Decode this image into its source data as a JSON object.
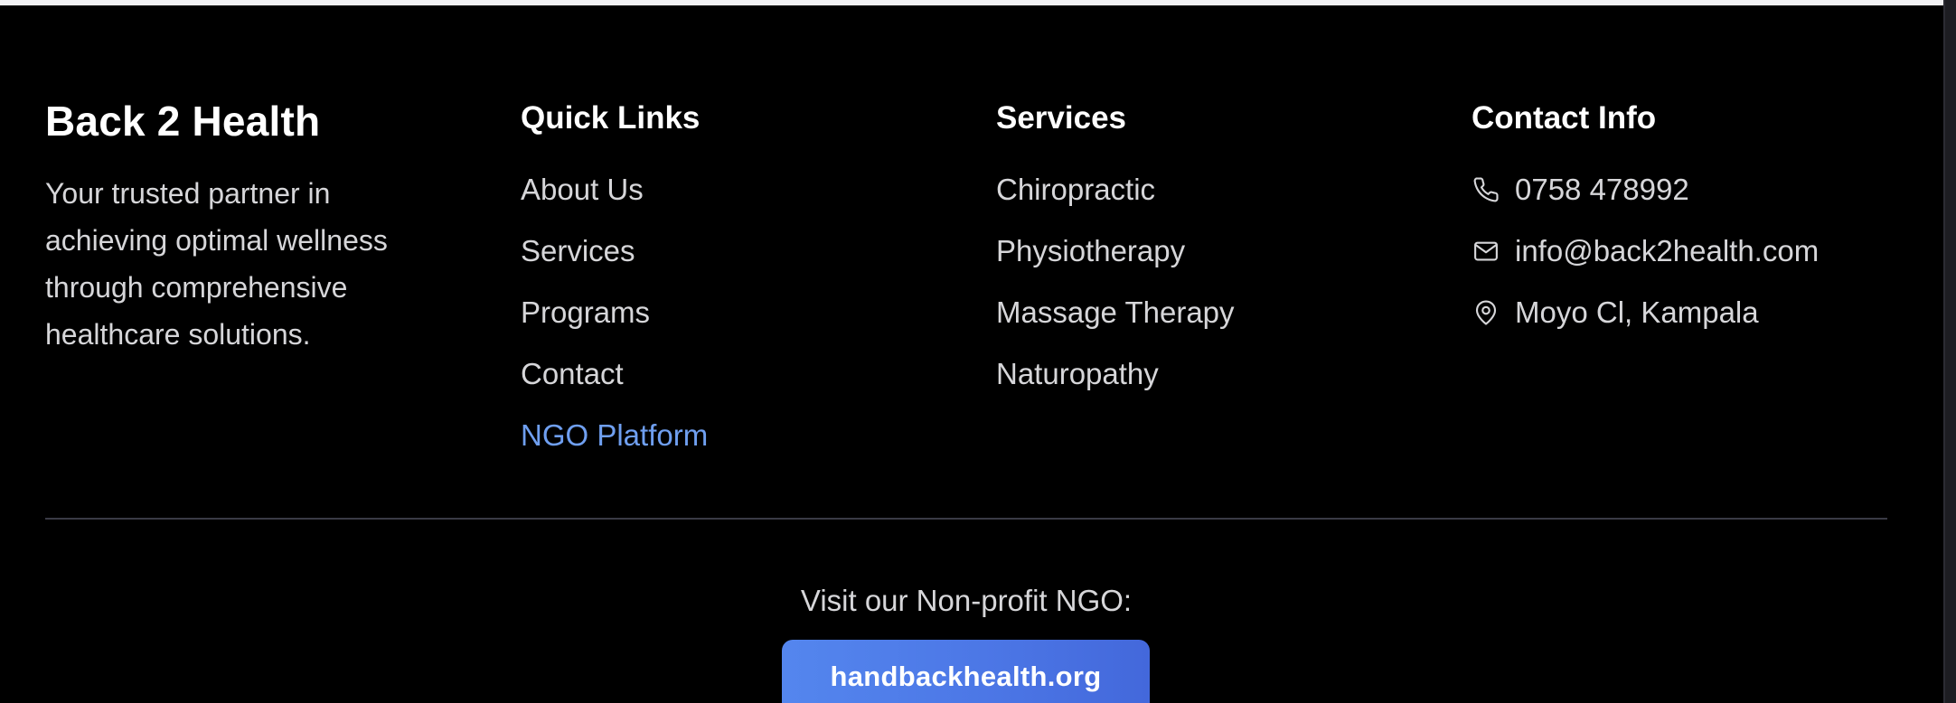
{
  "brand": {
    "title": "Back 2 Health",
    "tagline": "Your trusted partner in achieving optimal wellness through comprehensive healthcare solutions."
  },
  "quick_links": {
    "heading": "Quick Links",
    "items": [
      {
        "label": "About Us"
      },
      {
        "label": "Services"
      },
      {
        "label": "Programs"
      },
      {
        "label": "Contact"
      },
      {
        "label": "NGO Platform",
        "accent_color": "#6f9ff0"
      }
    ]
  },
  "services": {
    "heading": "Services",
    "items": [
      {
        "label": "Chiropractic"
      },
      {
        "label": "Physiotherapy"
      },
      {
        "label": "Massage Therapy"
      },
      {
        "label": "Naturopathy"
      }
    ]
  },
  "contact": {
    "heading": "Contact Info",
    "items": [
      {
        "icon": "phone-icon",
        "text": "0758 478992"
      },
      {
        "icon": "mail-icon",
        "text": "info@back2health.com"
      },
      {
        "icon": "map-pin-icon",
        "text": "Moyo Cl, Kampala"
      }
    ]
  },
  "ngo": {
    "label": "Visit our Non-profit NGO:",
    "button_label": "handbackhealth.org",
    "button_color": "#4c77e6"
  },
  "colors": {
    "background": "#000000",
    "text": "#d6d6d9",
    "heading": "#ffffff",
    "accent": "#6f9ff0"
  }
}
